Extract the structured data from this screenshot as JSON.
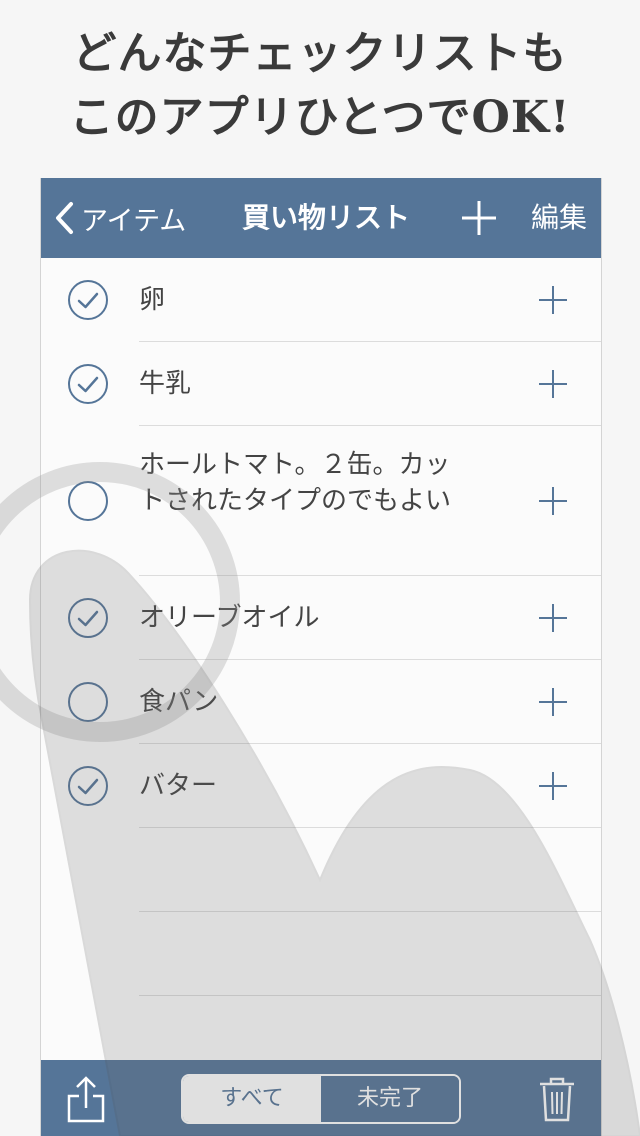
{
  "headline": {
    "line1": "どんなチェックリストも",
    "line2": "このアプリひとつでOK!"
  },
  "navbar": {
    "back_label": "アイテム",
    "title": "買い物リスト",
    "edit_label": "編集",
    "color": "#557598"
  },
  "items": [
    {
      "label": "卵",
      "checked": true
    },
    {
      "label": "牛乳",
      "checked": true
    },
    {
      "label": "ホールトマト。２缶。カットされたタイプのでもよい",
      "checked": false
    },
    {
      "label": "オリーブオイル",
      "checked": true
    },
    {
      "label": "食パン",
      "checked": false
    },
    {
      "label": "バター",
      "checked": true
    }
  ],
  "toolbar": {
    "segment_all": "すべて",
    "segment_incomplete": "未完了",
    "selected": "未完了"
  },
  "icons": {
    "back": "chevron-left-icon",
    "add": "plus-icon",
    "share": "share-icon",
    "trash": "trash-icon",
    "check": "check-circle-icon"
  }
}
